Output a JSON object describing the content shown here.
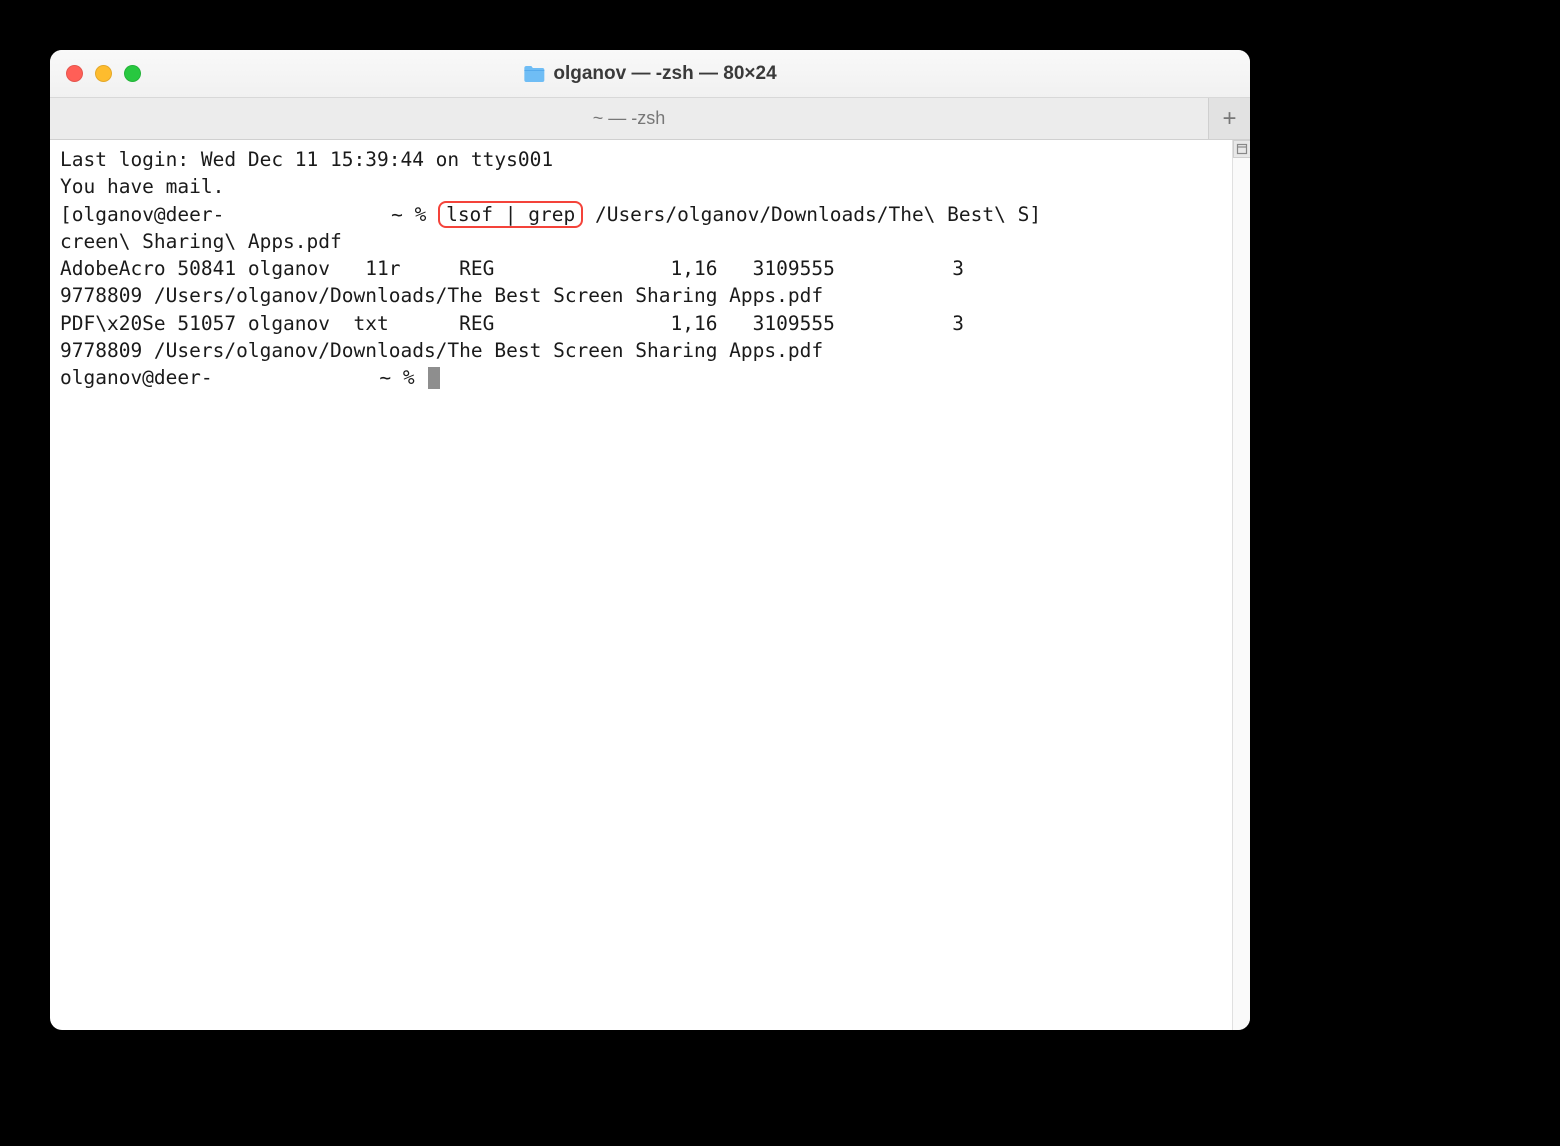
{
  "window": {
    "title": "olganov — -zsh — 80×24"
  },
  "tab": {
    "label": "~ — -zsh",
    "new_tab_glyph": "+"
  },
  "terminal": {
    "line1": "Last login: Wed Dec 11 15:39:44 on ttys001",
    "line2": "You have mail.",
    "prompt_bracket": "[",
    "prompt_user": "olganov@deer-",
    "prompt_suffix": " ~ % ",
    "highlighted_cmd": "lsof | grep",
    "cmd_arg_part1": " /Users/olganov/Downloads/The\\ Best\\ S]",
    "cmd_wrap": "creen\\ Sharing\\ Apps.pdf",
    "out1a": "AdobeAcro 50841 olganov   11r     REG               1,16   3109555          3",
    "out1b": "9778809 /Users/olganov/Downloads/The Best Screen Sharing Apps.pdf",
    "out2a": "PDF\\x20Se 51057 olganov  txt      REG               1,16   3109555          3",
    "out2b": "9778809 /Users/olganov/Downloads/The Best Screen Sharing Apps.pdf",
    "prompt2_user": "olganov@deer-",
    "prompt2_suffix": " ~ % "
  }
}
